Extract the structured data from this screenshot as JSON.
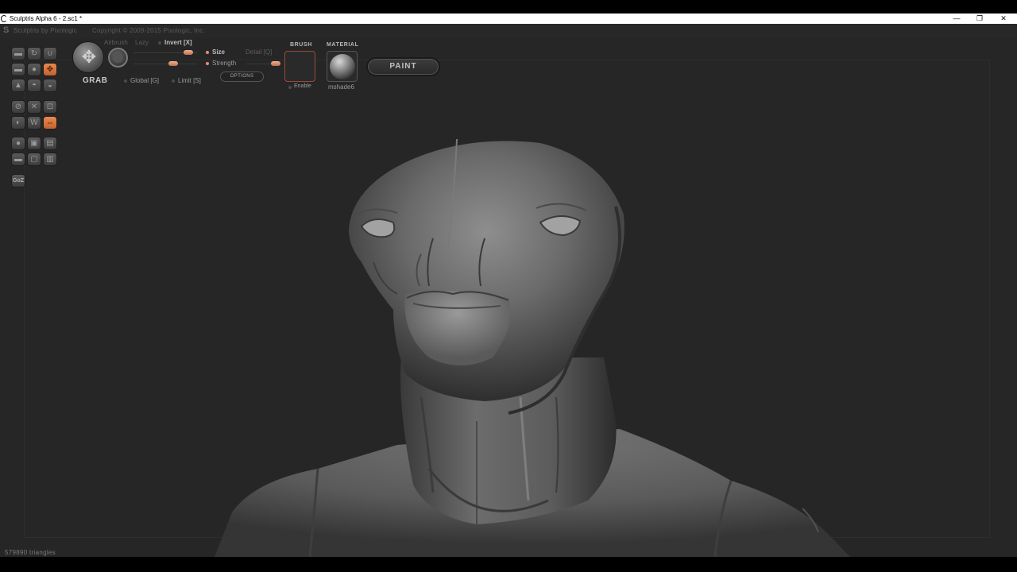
{
  "window": {
    "title": "Sculptris Alpha 6 - 2.sc1 *",
    "minimize": "—",
    "maximize": "❐",
    "close": "✕"
  },
  "app": {
    "brand": "Sculptris by Pixologic",
    "copyright": "Copyright © 2009-2015 Pixologic, Inc."
  },
  "toolbar": {
    "tool_name": "GRAB",
    "airbrush": "Airbrush",
    "lazy": "Lazy",
    "invert": "Invert [X]",
    "size": "Size",
    "strength": "Strength",
    "detail": "Detail [Q]",
    "global": "Global [G]",
    "limit": "Limit [S]",
    "options": "OPTIONS",
    "brush_title": "BRUSH",
    "brush_enable": "Enable",
    "material_title": "MATERIAL",
    "material_name": "mshade6",
    "paint": "PAINT"
  },
  "tools": {
    "goz": "GoZ"
  },
  "status": {
    "triangles": "579890 triangles"
  },
  "colors": {
    "accent": "#e0824a",
    "background": "#262626",
    "brush_border": "#9a4a3a"
  },
  "icons": [
    "grab-move-icon",
    "brush-circle-icon",
    "material-sphere-icon",
    "draw-icon",
    "rotate-icon",
    "crease-icon",
    "flatten-icon",
    "inflate-icon",
    "pinch-icon",
    "smooth-icon",
    "reduce-icon",
    "scale-icon",
    "symmetry-icon",
    "wireframe-icon",
    "mask-icon"
  ]
}
